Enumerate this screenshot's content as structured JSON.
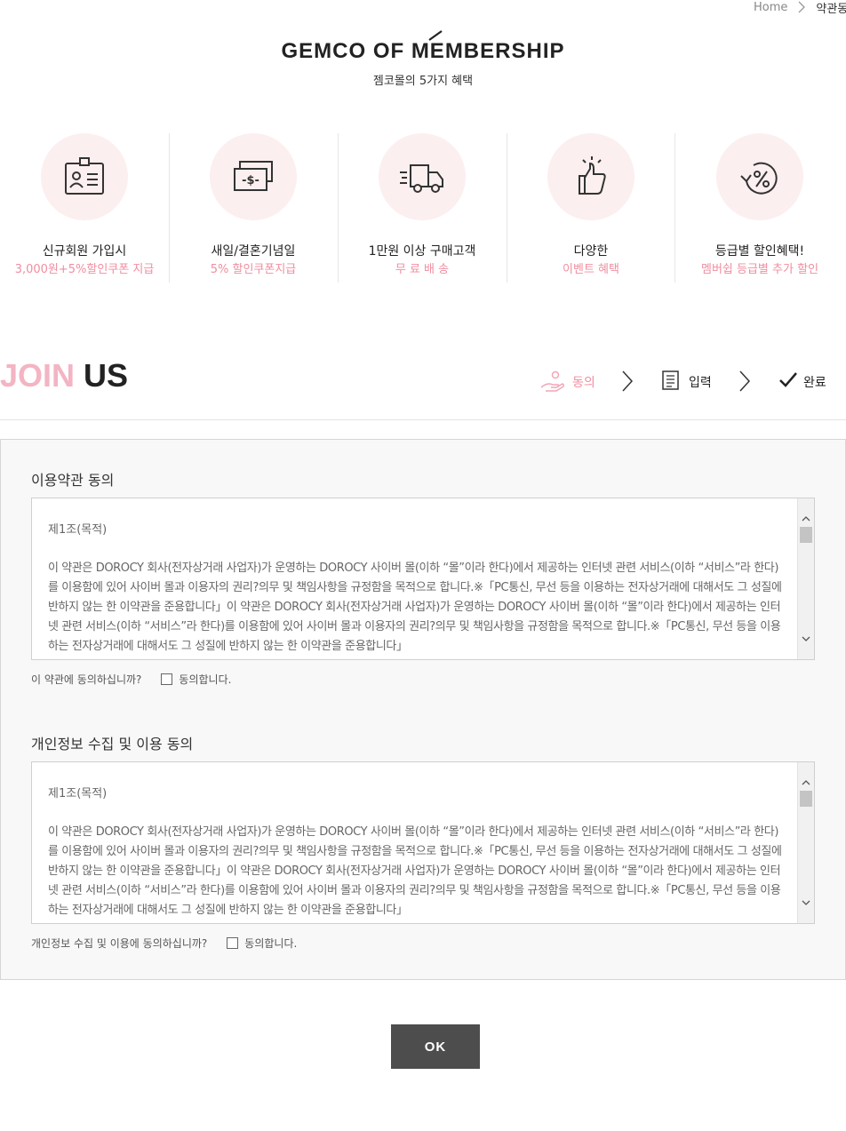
{
  "breadcrumb": {
    "home": "Home",
    "current": "약관동의"
  },
  "header": {
    "brand": "GEMCO OF MEMBERSHIP",
    "subtitle": "젬코몰의 5가지 혜택"
  },
  "benefits": [
    {
      "icon": "id-card-icon",
      "title": "신규회원 가입시",
      "desc": "3,000원+5%할인쿠폰 지급"
    },
    {
      "icon": "money-icon",
      "title": "새일/결혼기념일",
      "desc": "5% 할인쿠폰지급"
    },
    {
      "icon": "delivery-truck-icon",
      "title": "1만원 이상 구매고객",
      "desc": "무 료 배 송"
    },
    {
      "icon": "thumbs-up-icon",
      "title": "다양한",
      "desc": "이벤트 혜택"
    },
    {
      "icon": "discount-percent-icon",
      "title": "등급별 할인혜택!",
      "desc": "멤버쉽 등급별 추가 할인"
    }
  ],
  "join": {
    "word1": "JOIN",
    "word2": "US"
  },
  "steps": [
    {
      "icon": "hand-agree-icon",
      "label": "동의",
      "active": true
    },
    {
      "icon": "form-icon",
      "label": "입력",
      "active": false
    },
    {
      "icon": "check-icon",
      "label": "완료",
      "active": false
    }
  ],
  "terms": {
    "title": "이용약관 동의",
    "heading": "제1조(목적)",
    "body": "이 약관은 DOROCY 회사(전자상거래 사업자)가 운영하는 DOROCY 사이버 몰(이하 “몰”이라 한다)에서 제공하는 인터넷 관련 서비스(이하 “서비스”라 한다)를 이용함에 있어 사이버 몰과 이용자의 권리?의무 및 책임사항을 규정함을 목적으로 합니다.※「PC통신, 무선 등을 이용하는 전자상거래에 대해서도 그 성질에 반하지 않는 한 이약관을 준용합니다」이 약관은 DOROCY 회사(전자상거래 사업자)가 운영하는 DOROCY 사이버 몰(이하 “몰”이라 한다)에서 제공하는 인터넷 관련 서비스(이하 “서비스”라 한다)를 이용함에 있어 사이버 몰과 이용자의 권리?의무 및 책임사항을 규정함을 목적으로 합니다.※「PC통신, 무선 등을 이용하는 전자상거래에 대해서도 그 성질에 반하지 않는 한 이약관을 준용합니다」",
    "question": "이 약관에 동의하십니까?",
    "agree_label": "동의합니다."
  },
  "privacy": {
    "title": "개인정보 수집 및 이용 동의",
    "heading": "제1조(목적)",
    "body": "이 약관은 DOROCY 회사(전자상거래 사업자)가 운영하는 DOROCY 사이버 몰(이하 “몰”이라 한다)에서 제공하는 인터넷 관련 서비스(이하 “서비스”라 한다)를 이용함에 있어 사이버 몰과 이용자의 권리?의무 및 책임사항을 규정함을 목적으로 합니다.※「PC통신, 무선 등을 이용하는 전자상거래에 대해서도 그 성질에 반하지 않는 한 이약관을 준용합니다」이 약관은 DOROCY 회사(전자상거래 사업자)가 운영하는 DOROCY 사이버 몰(이하 “몰”이라 한다)에서 제공하는 인터넷 관련 서비스(이하 “서비스”라 한다)를 이용함에 있어 사이버 몰과 이용자의 권리?의무 및 책임사항을 규정함을 목적으로 합니다.※「PC통신, 무선 등을 이용하는 전자상거래에 대해서도 그 성질에 반하지 않는 한 이약관을 준용합니다」",
    "question": "개인정보 수집 및 이용에 동의하십니까?",
    "agree_label": "동의합니다."
  },
  "ok_label": "OK",
  "colors": {
    "accent": "#f08ea0",
    "join_pink": "#f3b4c3",
    "circle_bg": "#fcefef",
    "button_bg": "#4d4d4d"
  }
}
